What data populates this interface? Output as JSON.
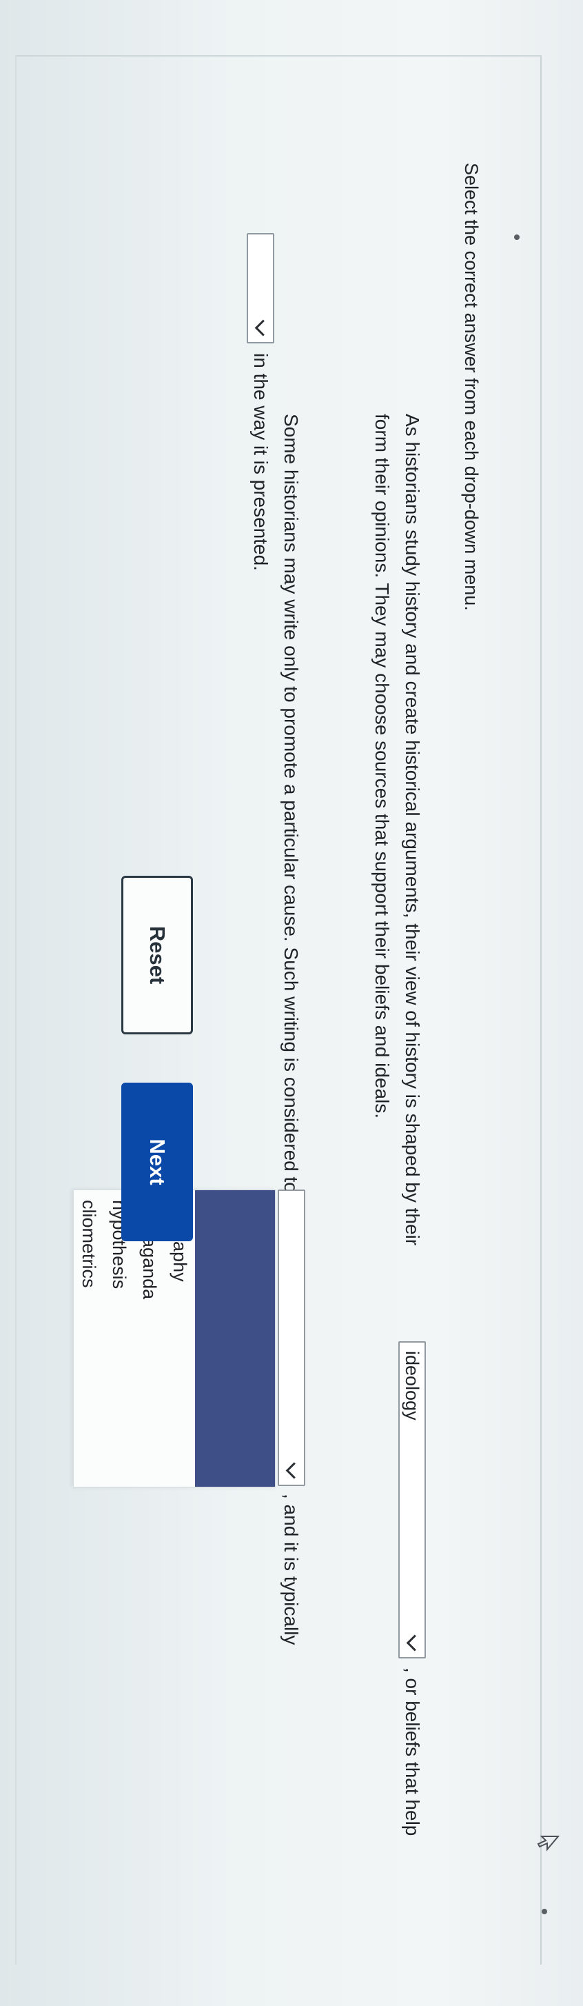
{
  "instruction": "Select the correct answer from each drop-down menu.",
  "paragraph1": {
    "before_select": "As historians study history and create historical arguments, their view of history is shaped by their",
    "selected_value": "ideology",
    "after_select": ", or beliefs that help",
    "line2": "form their opinions. They may choose sources that support their beliefs and ideals."
  },
  "paragraph2": {
    "before_select": "Some historians may write only to promote a particular cause. Such writing is considered to be",
    "after_select": ", and it is typically",
    "line2_after_select": "in the way it is presented."
  },
  "dropdown_options": [
    "biography",
    "propaganda",
    "hypothesis",
    "cliometrics"
  ],
  "buttons": {
    "reset": "Reset",
    "next": "Next"
  },
  "colors": {
    "next_button": "#0b49a8",
    "highlight": "#3d4f86"
  }
}
